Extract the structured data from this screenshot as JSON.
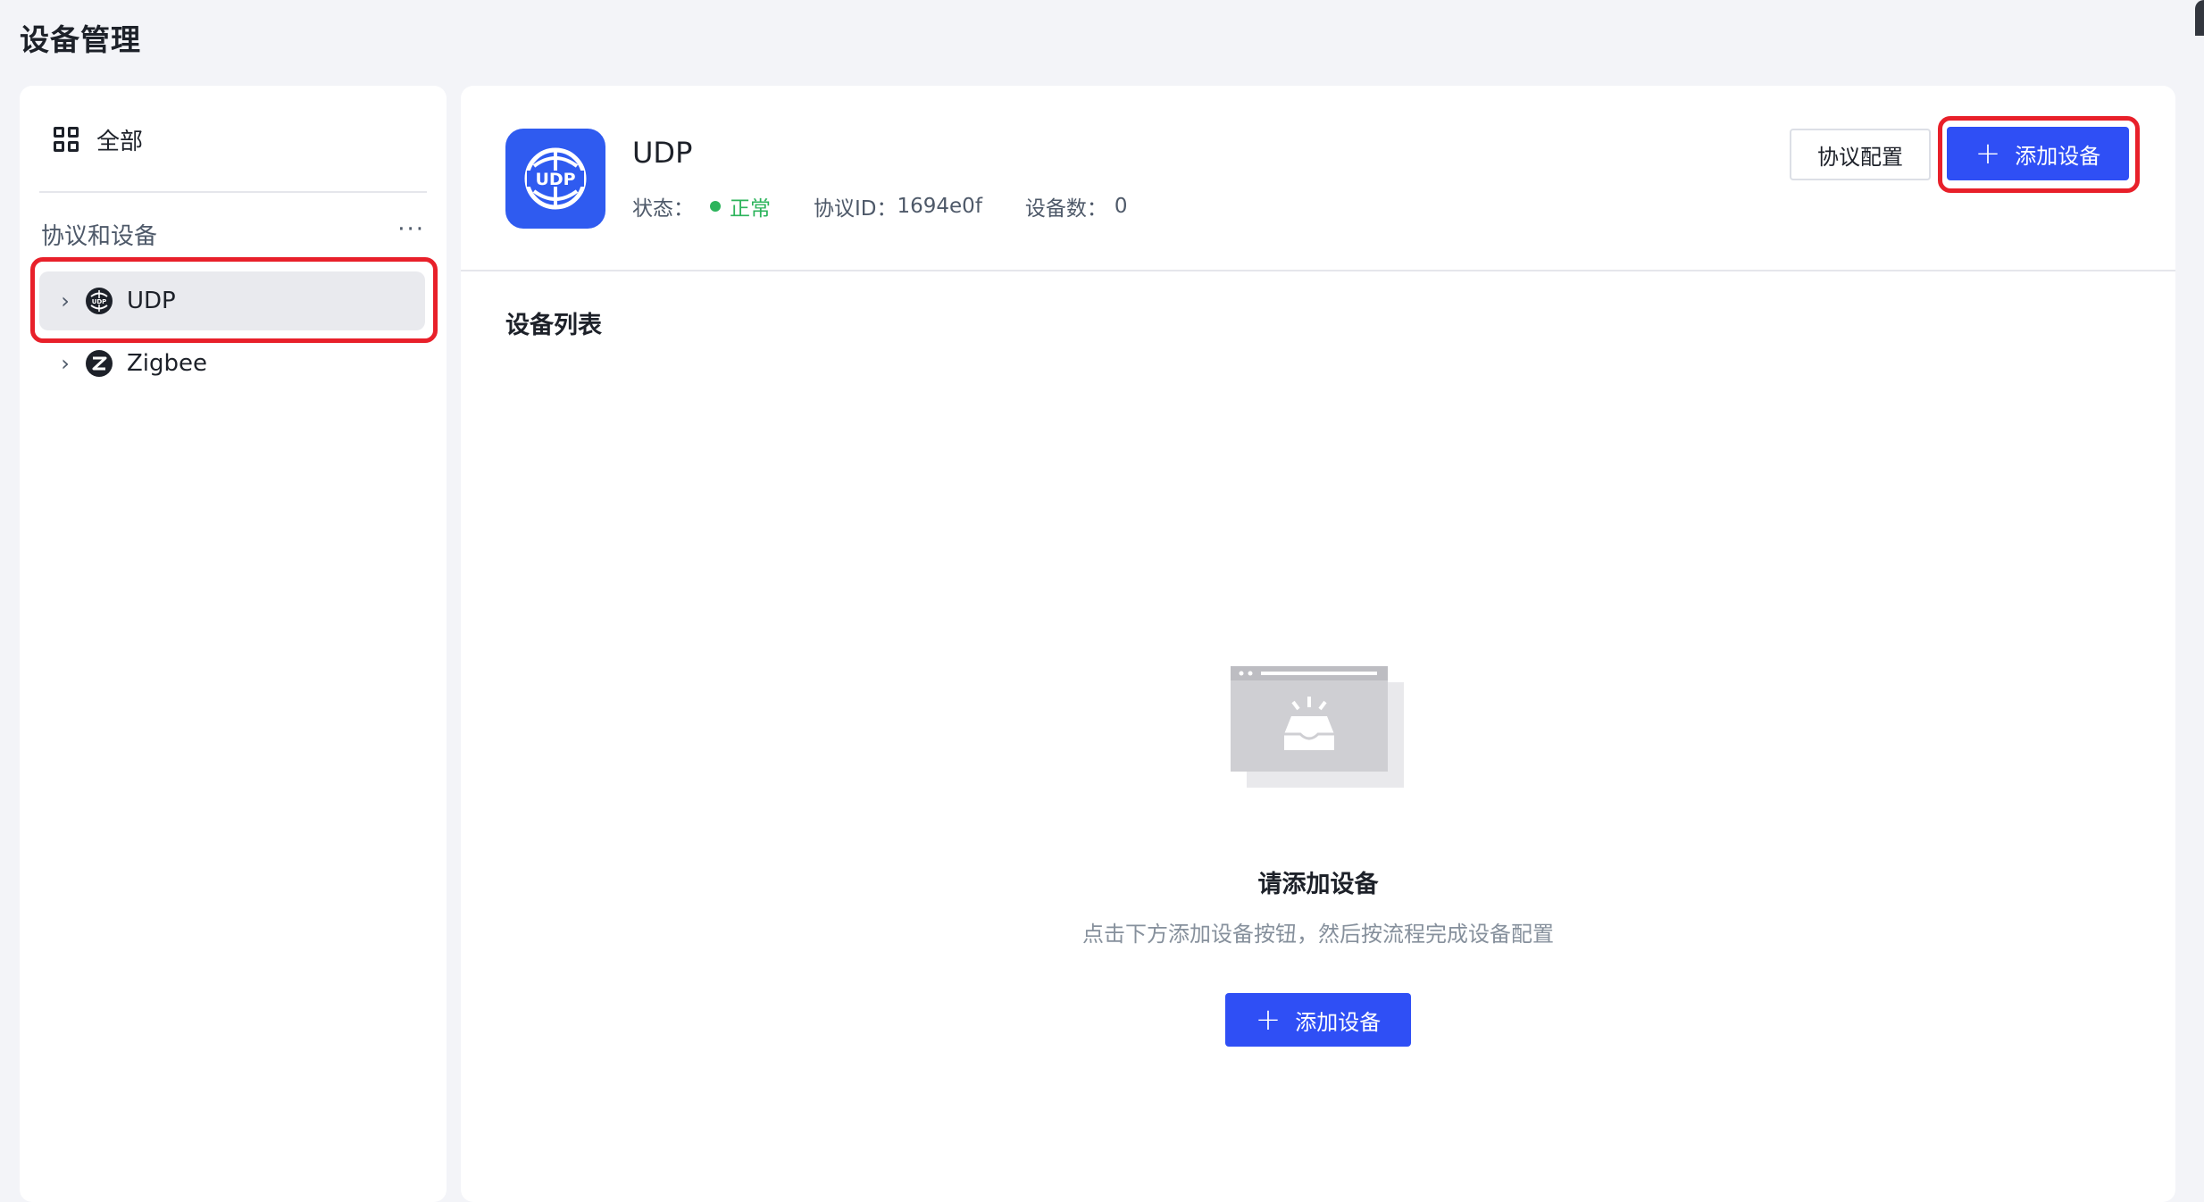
{
  "page": {
    "title": "设备管理"
  },
  "sidebar": {
    "all_label": "全部",
    "group_title": "协议和设备",
    "group_more": "···",
    "items": [
      {
        "label": "UDP",
        "icon": "udp-globe-icon",
        "selected": true
      },
      {
        "label": "Zigbee",
        "icon": "zigbee-icon",
        "selected": false
      }
    ]
  },
  "protocol": {
    "name": "UDP",
    "logo_text": "UDP",
    "status_label": "状态：",
    "status_value": "正常",
    "id_label": "协议ID：",
    "id_value": "1694e0f",
    "device_count_label": "设备数：",
    "device_count_value": "0"
  },
  "toolbar": {
    "config_label": "协议配置",
    "add_label": "添加设备"
  },
  "device_list": {
    "title": "设备列表",
    "empty_title": "请添加设备",
    "empty_desc": "点击下方添加设备按钮，然后按流程完成设备配置",
    "add_label": "添加设备"
  },
  "colors": {
    "primary": "#2f4ff5",
    "logo_bg": "#2f5bf0",
    "status_ok": "#2db45c",
    "highlight": "#e8202a",
    "page_bg": "#f3f4f8"
  }
}
